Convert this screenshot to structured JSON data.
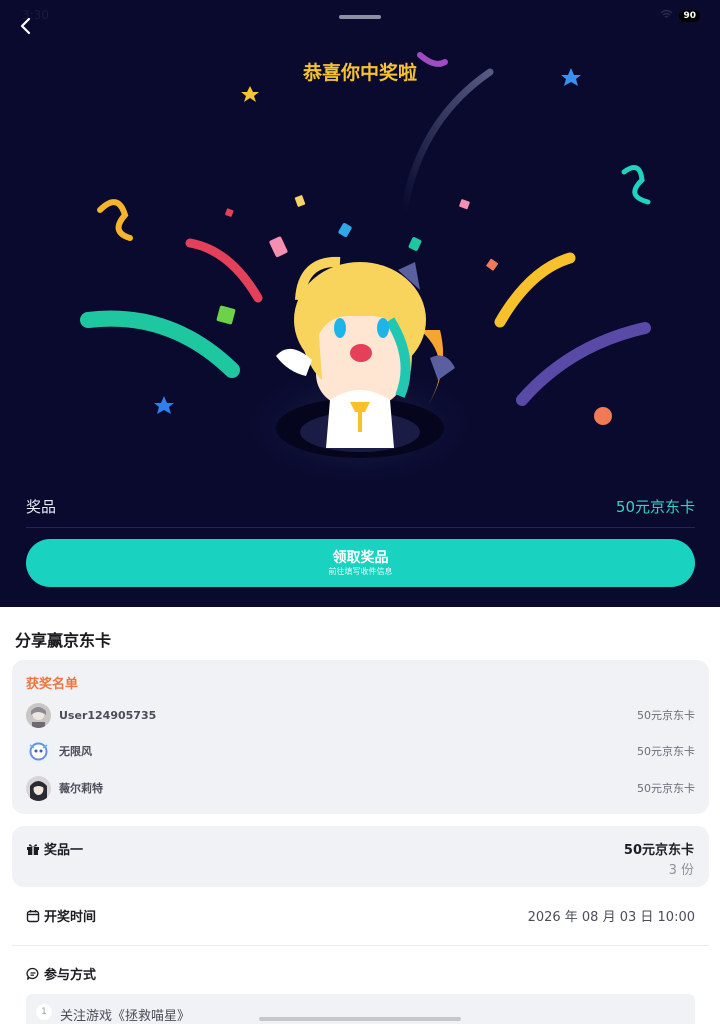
{
  "status_bar": {
    "time": "3:30",
    "battery": "90"
  },
  "hero": {
    "title": "恭喜你中奖啦",
    "prize_label": "奖品",
    "prize_value": "50元京东卡",
    "claim_button": {
      "label": "领取奖品",
      "sublabel": "前往填写收件信息"
    }
  },
  "share": {
    "title": "分享赢京东卡",
    "winners_title": "获奖名单",
    "winners": [
      {
        "name": "User124905735",
        "prize": "50元京东卡"
      },
      {
        "name": "无限风",
        "prize": "50元京东卡"
      },
      {
        "name": "薇尔莉特",
        "prize": "50元京东卡"
      }
    ]
  },
  "prize_tier": {
    "label": "奖品一",
    "value": "50元京东卡",
    "count": "3 份"
  },
  "draw": {
    "label": "开奖时间",
    "time": "2026 年 08 月 03 日 10:00"
  },
  "participation": {
    "label": "参与方式",
    "tasks": [
      {
        "num": "1",
        "text": "关注游戏《拯救喵星》"
      }
    ]
  },
  "colors": {
    "hero_bg": "#090a2e",
    "accent_teal": "#19d3c0",
    "title_gold": "#f7c230",
    "winners_orange": "#ef7540"
  },
  "icons": {
    "back": "chevron-left-icon",
    "gift": "gift-icon",
    "calendar": "calendar-icon",
    "chat": "chat-bubble-icon"
  }
}
